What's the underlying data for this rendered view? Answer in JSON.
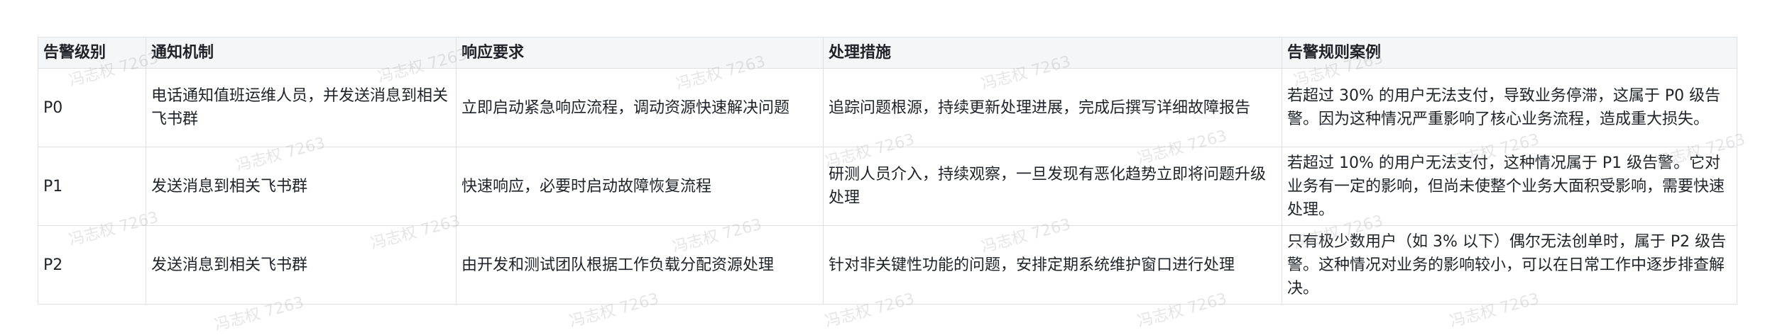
{
  "table": {
    "headers": [
      "告警级别",
      "通知机制",
      "响应要求",
      "处理措施",
      "告警规则案例"
    ],
    "rows": [
      {
        "level": "P0",
        "notify": "电话通知值班运维人员，并发送消息到相关飞书群",
        "response": "立即启动紧急响应流程，调动资源快速解决问题",
        "action": "追踪问题根源，持续更新处理进展，完成后撰写详细故障报告",
        "example": "若超过 30% 的用户无法支付，导致业务停滞，这属于 P0 级告警。因为这种情况严重影响了核心业务流程，造成重大损失。"
      },
      {
        "level": "P1",
        "notify": "发送消息到相关飞书群",
        "response": "快速响应，必要时启动故障恢复流程",
        "action": "研测人员介入，持续观察，一旦发现有恶化趋势立即将问题升级处理",
        "example": "若超过 10% 的用户无法支付，这种情况属于 P1 级告警。它对业务有一定的影响，但尚未使整个业务大面积受影响，需要快速处理。"
      },
      {
        "level": "P2",
        "notify": "发送消息到相关飞书群",
        "response": "由开发和测试团队根据工作负载分配资源处理",
        "action": "针对非关键性功能的问题，安排定期系统维护窗口进行处理",
        "example": "只有极少数用户（如 3% 以下）偶尔无法创单时，属于 P2 级告警。这种情况对业务的影响较小，可以在日常工作中逐步排查解决。"
      }
    ]
  },
  "watermark": "冯志权 7263"
}
